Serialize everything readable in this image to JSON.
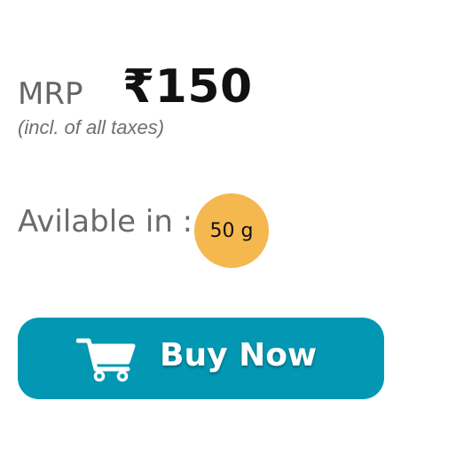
{
  "pricing": {
    "mrp_label": "MRP",
    "price": "₹150",
    "tax_note": "(incl. of all taxes)"
  },
  "availability": {
    "label": "Avilable in :",
    "options": [
      {
        "label": "50 g",
        "color": "#f5b84f"
      }
    ]
  },
  "actions": {
    "buy_label": "Buy Now",
    "buy_icon": "cart-icon",
    "button_color": "#0298b3"
  }
}
